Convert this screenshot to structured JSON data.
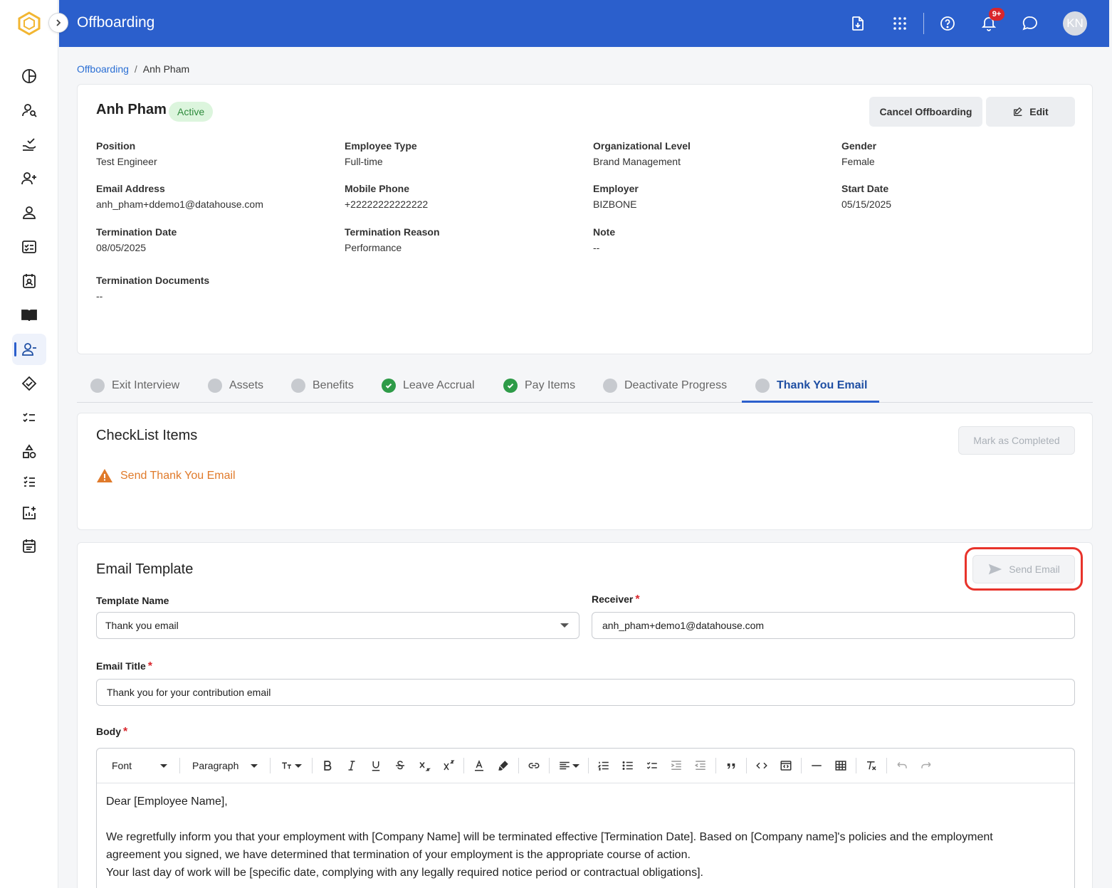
{
  "app": {
    "title": "Offboarding"
  },
  "topbar": {
    "notifications_count": "9+",
    "avatar_initials": "KN"
  },
  "breadcrumb": {
    "root": "Offboarding",
    "current": "Anh Pham"
  },
  "employee": {
    "name": "Anh Pham",
    "status": "Active",
    "actions": {
      "cancel_label": "Cancel Offboarding",
      "edit_label": "Edit"
    },
    "fields": [
      {
        "label": "Position",
        "value": "Test Engineer"
      },
      {
        "label": "Employee Type",
        "value": "Full-time"
      },
      {
        "label": "Organizational Level",
        "value": "Brand Management"
      },
      {
        "label": "Gender",
        "value": "Female"
      },
      {
        "label": "Email Address",
        "value": "anh_pham+ddemo1@datahouse.com"
      },
      {
        "label": "Mobile Phone",
        "value": "+22222222222222"
      },
      {
        "label": "Employer",
        "value": "BIZBONE"
      },
      {
        "label": "Start Date",
        "value": "05/15/2025"
      },
      {
        "label": "Termination Date",
        "value": "08/05/2025"
      },
      {
        "label": "Termination Reason",
        "value": "Performance"
      },
      {
        "label": "Note",
        "value": "--"
      },
      {
        "label": "Termination Documents",
        "value": "--"
      }
    ]
  },
  "tabs": [
    {
      "label": "Exit Interview",
      "state": "pending"
    },
    {
      "label": "Assets",
      "state": "pending"
    },
    {
      "label": "Benefits",
      "state": "pending"
    },
    {
      "label": "Leave Accrual",
      "state": "done"
    },
    {
      "label": "Pay Items",
      "state": "done"
    },
    {
      "label": "Deactivate Progress",
      "state": "pending"
    },
    {
      "label": "Thank You Email",
      "state": "active"
    }
  ],
  "checklist": {
    "title": "CheckList Items",
    "mark_completed_label": "Mark as Completed",
    "items": [
      {
        "label": "Send Thank You Email",
        "icon": "warning-icon"
      }
    ]
  },
  "email_template": {
    "title": "Email Template",
    "send_label": "Send Email",
    "template_name": {
      "label": "Template Name",
      "value": "Thank you email"
    },
    "receiver": {
      "label": "Receiver",
      "required": "*",
      "value": "anh_pham+demo1@datahouse.com"
    },
    "email_title": {
      "label": "Email Title",
      "required": "*",
      "value": "Thank you for your contribution email"
    },
    "body": {
      "label": "Body",
      "required": "*",
      "toolbar": {
        "font": "Font",
        "paragraph": "Paragraph"
      },
      "lines": [
        "Dear [Employee Name],",
        "We regretfully inform you that your employment with [Company Name] will be terminated effective [Termination Date]. Based on [Company name]'s policies and the employment agreement you signed, we have determined that termination of your employment is the appropriate course of action.",
        "Your last day of work will be [specific date, complying with any legally required notice period or contractual obligations]."
      ]
    }
  },
  "colors": {
    "primary": "#2b5fcc",
    "success": "#2e9b48",
    "warning": "#e07a2a",
    "danger": "#d9262c"
  }
}
